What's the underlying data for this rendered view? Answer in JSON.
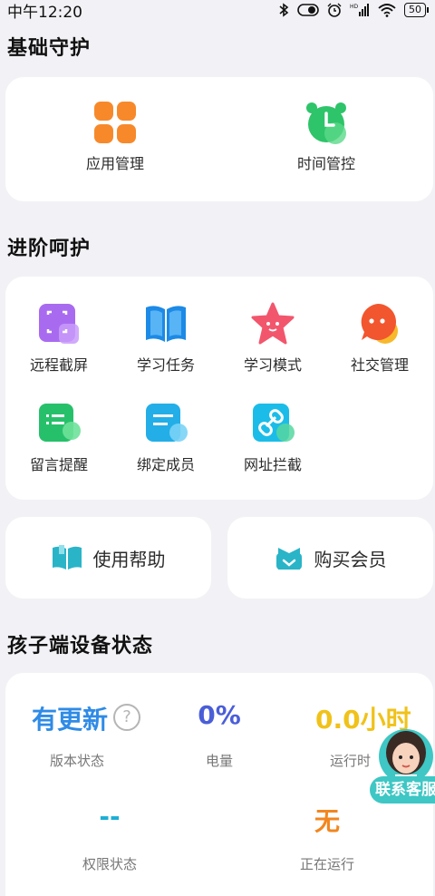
{
  "status_bar": {
    "time": "中午12:20",
    "battery": "50"
  },
  "basic": {
    "title": "基础守护",
    "items": [
      {
        "label": "应用管理",
        "icon": "app-grid-icon"
      },
      {
        "label": "时间管控",
        "icon": "alarm-clock-icon"
      }
    ]
  },
  "advanced": {
    "title": "进阶呵护",
    "items": [
      {
        "label": "远程截屏",
        "icon": "screenshot-icon"
      },
      {
        "label": "学习任务",
        "icon": "book-icon"
      },
      {
        "label": "学习模式",
        "icon": "star-icon"
      },
      {
        "label": "社交管理",
        "icon": "chat-bubble-icon"
      },
      {
        "label": "留言提醒",
        "icon": "message-icon"
      },
      {
        "label": "绑定成员",
        "icon": "member-card-icon"
      },
      {
        "label": "网址拦截",
        "icon": "link-icon"
      }
    ]
  },
  "actions": {
    "help": {
      "label": "使用帮助",
      "icon": "help-book-icon"
    },
    "vip": {
      "label": "购买会员",
      "icon": "vip-box-icon"
    }
  },
  "device": {
    "title": "孩子端设备状态",
    "stats": [
      {
        "value": "有更新",
        "label": "版本状态",
        "color": "#2f8be6"
      },
      {
        "value": "0%",
        "label": "电量",
        "color": "#4a5ed8"
      },
      {
        "value": "0.0小时",
        "label": "运行时",
        "color": "#f0c21a"
      },
      {
        "value": "--",
        "label": "权限状态",
        "color": "#1aaed6"
      },
      {
        "value": "无",
        "label": "正在运行",
        "color": "#f2861f"
      }
    ],
    "help_mark": "?"
  },
  "customer_service": {
    "label": "联系客服",
    "icon": "agent-avatar-icon"
  }
}
